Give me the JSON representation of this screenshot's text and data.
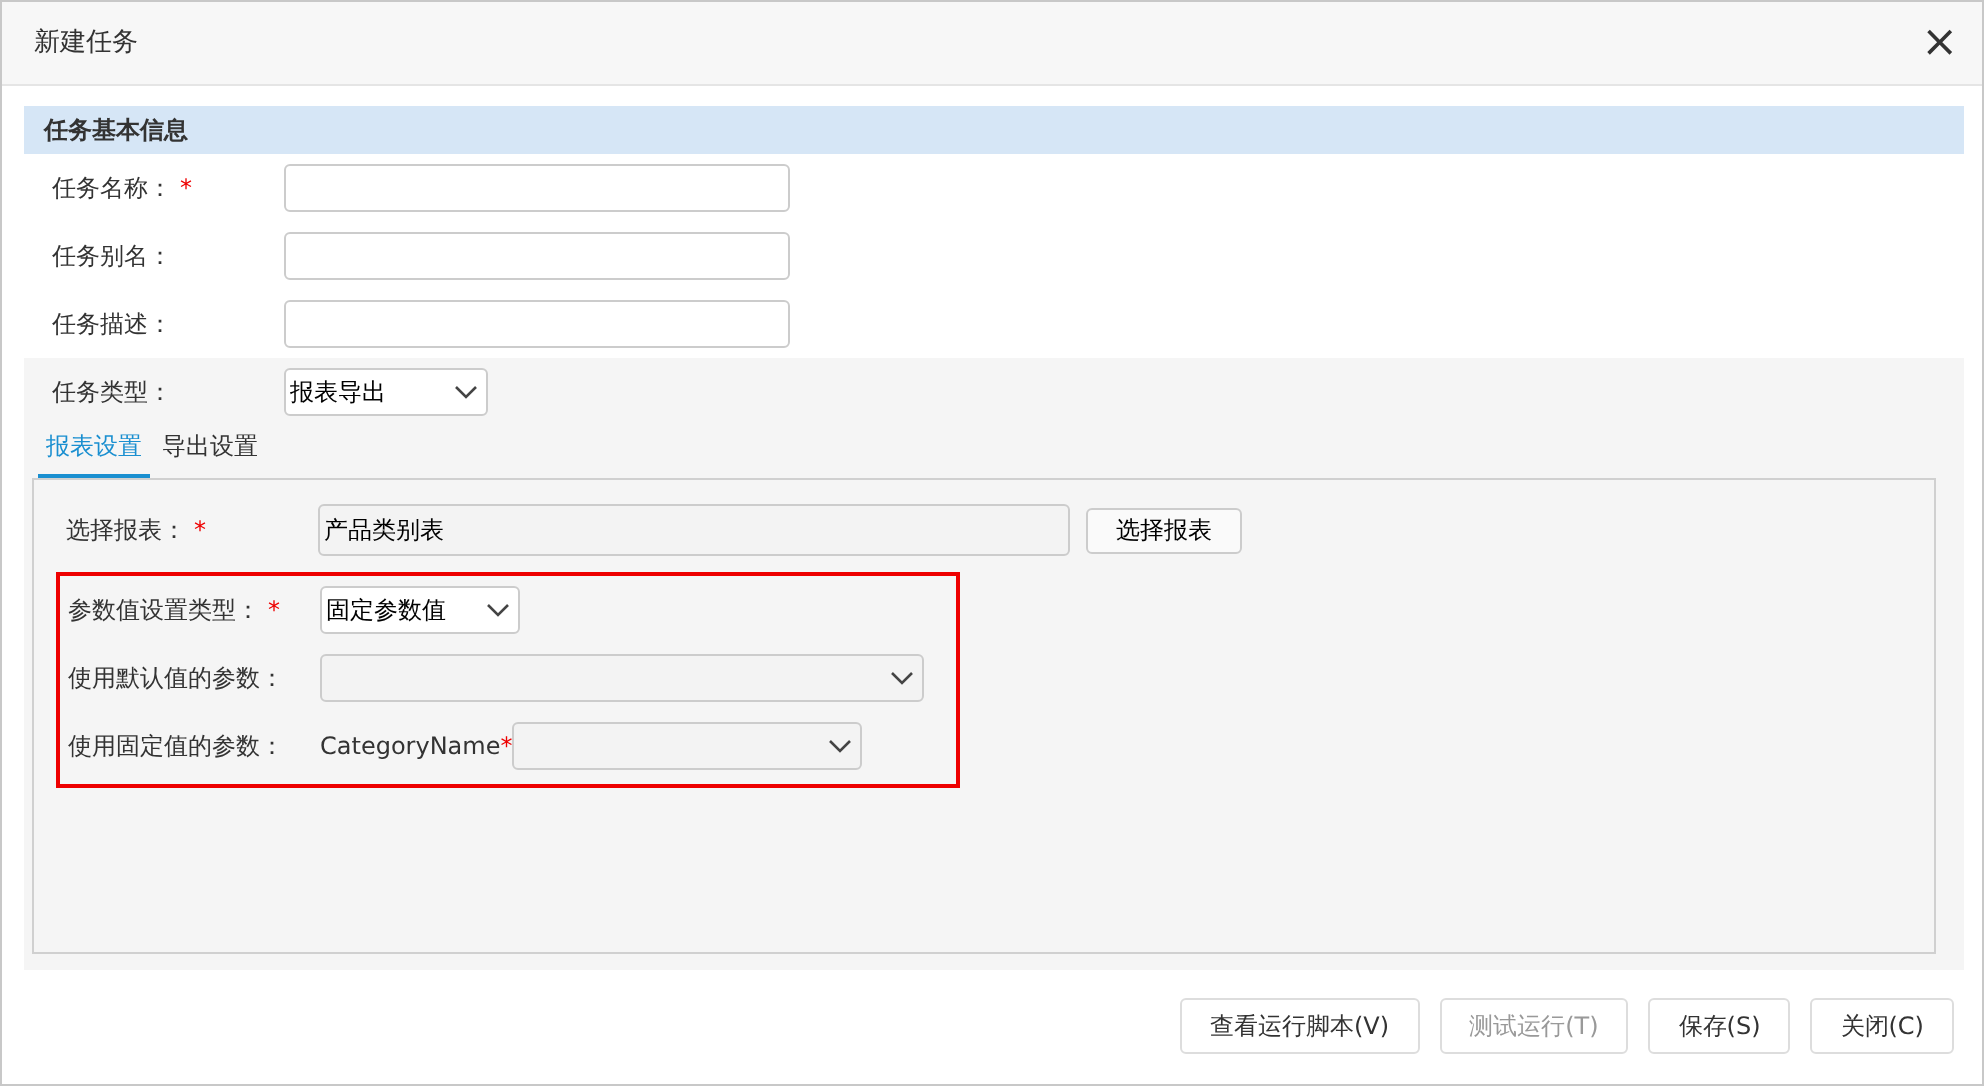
{
  "window": {
    "title": "新建任务",
    "close": "×"
  },
  "section": {
    "title": "任务基本信息"
  },
  "fields": [
    {
      "kind": "text",
      "label": "任务名称：",
      "required_mark": "*"
    },
    {
      "kind": "text",
      "label": "任务别名："
    },
    {
      "kind": "text",
      "label": "任务描述："
    },
    {
      "kind": "select",
      "label": "任务类型：",
      "value": "报表导出"
    }
  ],
  "tabs": [
    {
      "label": "报表设置",
      "selected": true
    },
    {
      "label": "导出设置",
      "selected": false
    }
  ],
  "panel_rows": [
    {
      "kind": "report",
      "label": "选择报表：",
      "required_mark": "*",
      "value": "产品类别表",
      "button": "选择报表",
      "highlighted": false
    },
    {
      "kind": "select",
      "label": "参数值设置类型：",
      "required_mark": "*",
      "value": "固定参数值",
      "highlighted": true
    },
    {
      "kind": "wide-select",
      "label": "使用默认值的参数：",
      "highlighted": true
    },
    {
      "kind": "param-select",
      "label": "使用固定值的参数：",
      "param": "CategoryName",
      "param_mark": "*",
      "highlighted": true
    }
  ],
  "buttons": [
    {
      "label": "查看运行脚本(V)",
      "disabled": false
    },
    {
      "label": "测试运行(T)",
      "disabled": true
    },
    {
      "label": "保存(S)",
      "disabled": false
    },
    {
      "label": "关闭(C)",
      "disabled": false
    }
  ]
}
